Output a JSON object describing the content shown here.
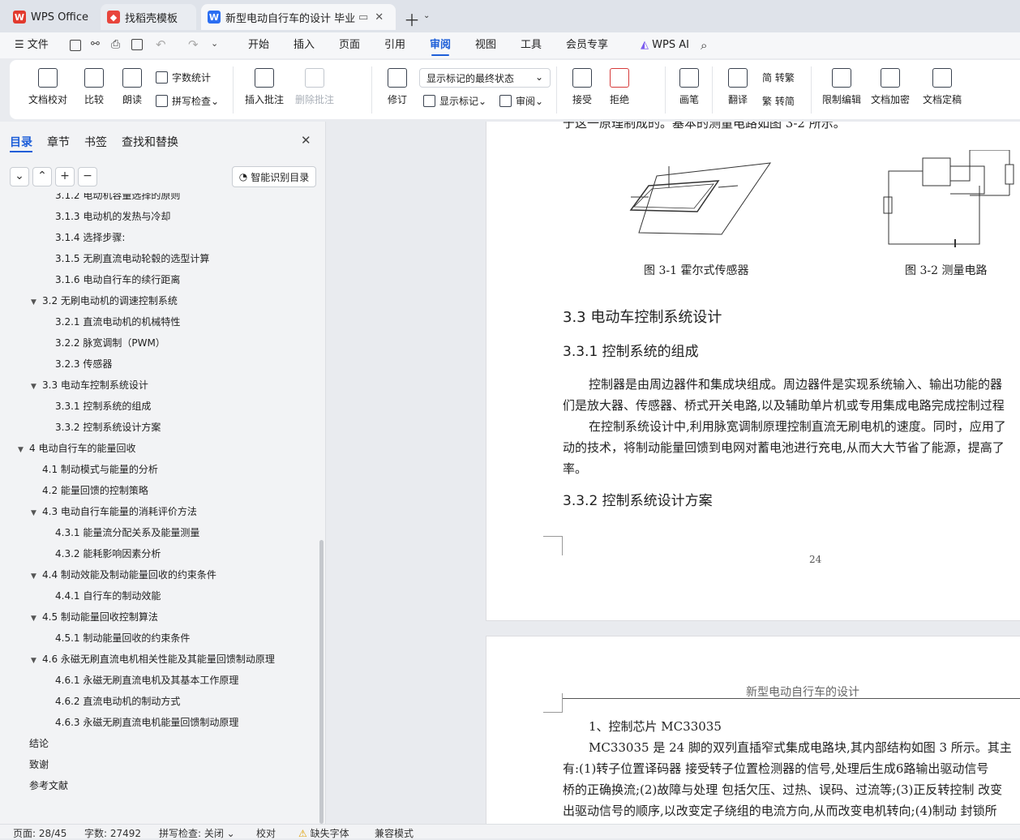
{
  "tabs": [
    {
      "label": "WPS Office",
      "icon": "wps-logo-icon",
      "color": "#e23a2e"
    },
    {
      "label": "找稻壳模板",
      "icon": "docer-logo-icon",
      "color": "#e8453c"
    },
    {
      "label": "新型电动自行车的设计 毕业论",
      "icon": "word-doc-icon",
      "color": "#2b6ef2"
    }
  ],
  "menu": {
    "file": "文件",
    "tabs": [
      "开始",
      "插入",
      "页面",
      "引用",
      "审阅",
      "视图",
      "工具",
      "会员专享"
    ],
    "active": "审阅",
    "ai": "WPS AI"
  },
  "ribbon": {
    "doc_check": "文档校对",
    "compare": "比较",
    "read": "朗读",
    "word_count": "字数统计",
    "spell_check": "拼写检查",
    "insert_comment": "插入批注",
    "delete_comment": "删除批注",
    "track": "修订",
    "markup_state": "显示标记的最终状态",
    "show_markup": "显示标记",
    "review": "审阅",
    "accept": "接受",
    "reject": "拒绝",
    "pen": "画笔",
    "translate": "翻译",
    "to_trad": "简 转繁",
    "to_simp": "繁 转简",
    "restrict": "限制编辑",
    "encrypt": "文档加密",
    "finalize": "文档定稿"
  },
  "nav": {
    "tabs": [
      "目录",
      "章节",
      "书签",
      "查找和替换"
    ],
    "smart_toc": "智能识别目录"
  },
  "toc": [
    {
      "level": 3,
      "text": "3.1.2  电动机容量选择的原则",
      "arrow": ""
    },
    {
      "level": 3,
      "text": "3.1.3  电动机的发热与冷却",
      "arrow": ""
    },
    {
      "level": 3,
      "text": "3.1.4  选择步骤:",
      "arrow": ""
    },
    {
      "level": 3,
      "text": "3.1.5  无刷直流电动轮毂的选型计算",
      "arrow": ""
    },
    {
      "level": 3,
      "text": "3.1.6  电动自行车的续行距离",
      "arrow": ""
    },
    {
      "level": 2,
      "text": "3.2  无刷电动机的调速控制系统",
      "arrow": "▼"
    },
    {
      "level": 3,
      "text": "3.2.1  直流电动机的机械特性",
      "arrow": ""
    },
    {
      "level": 3,
      "text": "3.2.2  脉宽调制（PWM）",
      "arrow": ""
    },
    {
      "level": 3,
      "text": "3.2.3  传感器",
      "arrow": ""
    },
    {
      "level": 2,
      "text": "3.3  电动车控制系统设计",
      "arrow": "▼"
    },
    {
      "level": 3,
      "text": "3.3.1  控制系统的组成",
      "arrow": ""
    },
    {
      "level": 3,
      "text": "3.3.2  控制系统设计方案",
      "arrow": ""
    },
    {
      "level": 1,
      "text": "4  电动自行车的能量回收",
      "arrow": "▼"
    },
    {
      "level": 2,
      "text": "4.1  制动模式与能量的分析",
      "arrow": ""
    },
    {
      "level": 2,
      "text": "4.2  能量回馈的控制策略",
      "arrow": ""
    },
    {
      "level": 2,
      "text": "4.3  电动自行车能量的消耗评价方法",
      "arrow": "▼"
    },
    {
      "level": 3,
      "text": "4.3.1  能量流分配关系及能量测量",
      "arrow": ""
    },
    {
      "level": 3,
      "text": "4.3.2  能耗影响因素分析",
      "arrow": ""
    },
    {
      "level": 2,
      "text": "4.4  制动效能及制动能量回收的约束条件",
      "arrow": "▼"
    },
    {
      "level": 3,
      "text": "4.4.1  自行车的制动效能",
      "arrow": ""
    },
    {
      "level": 2,
      "text": "4.5  制动能量回收控制算法",
      "arrow": "▼"
    },
    {
      "level": 3,
      "text": "4.5.1  制动能量回收的约束条件",
      "arrow": ""
    },
    {
      "level": 2,
      "text": "4.6  永磁无刷直流电机相关性能及其能量回馈制动原理",
      "arrow": "▼"
    },
    {
      "level": 3,
      "text": "4.6.1  永磁无刷直流电机及其基本工作原理",
      "arrow": ""
    },
    {
      "level": 3,
      "text": "4.6.2  直流电动机的制动方式",
      "arrow": ""
    },
    {
      "level": 3,
      "text": "4.6.3  永磁无刷直流电机能量回馈制动原理",
      "arrow": ""
    },
    {
      "level": 1,
      "text": "结论",
      "arrow": ""
    },
    {
      "level": 1,
      "text": "致谢",
      "arrow": ""
    },
    {
      "level": 1,
      "text": "参考文献",
      "arrow": ""
    }
  ],
  "page1": {
    "line_top": "于这一原理制成的。基本的测量电路如图 3-2 所示。",
    "fig1_caption": "图 3-1  霍尔式传感器",
    "fig2_caption": "图 3-2  测量电路",
    "h_33": "3.3  电动车控制系统设计",
    "h_331": "3.3.1  控制系统的组成",
    "p1a": "控制器是由周边器件和集成块组成。周边器件是实现系统输入、输出功能的器",
    "p1b": "们是放大器、传感器、桥式开关电路,以及辅助单片机或专用集成电路完成控制过程",
    "p2a": "在控制系统设计中,利用脉宽调制原理控制直流无刷电机的速度。同时，应用了",
    "p2b": "动的技术，将制动能量回馈到电网对蓄电池进行充电,从而大大节省了能源，提高了",
    "p2c": "率。",
    "h_332": "3.3.2  控制系统设计方案",
    "page_no": "24"
  },
  "page2": {
    "header": "新型电动自行车的设计",
    "l1": "1、控制芯片 MC33035",
    "l2": "MC33035 是 24 脚的双列直插窄式集成电路块,其内部结构如图 3 所示。其主",
    "l3": "有:(1)转子位置译码器  接受转子位置检测器的信号,处理后生成6路输出驱动信号",
    "l4": "桥的正确换流;(2)故障与处理  包括欠压、过热、误码、过流等;(3)正反转控制  改变",
    "l5": "出驱动信号的顺序,以改变定子绕组的电流方向,从而改变电机转向;(4)制动  封锁所"
  },
  "status": {
    "page": "页面: 28/45",
    "words": "字数: 27492",
    "spell": "拼写检查: 关闭",
    "proof": "校对",
    "missing_font": "缺失字体",
    "compat": "兼容模式"
  }
}
